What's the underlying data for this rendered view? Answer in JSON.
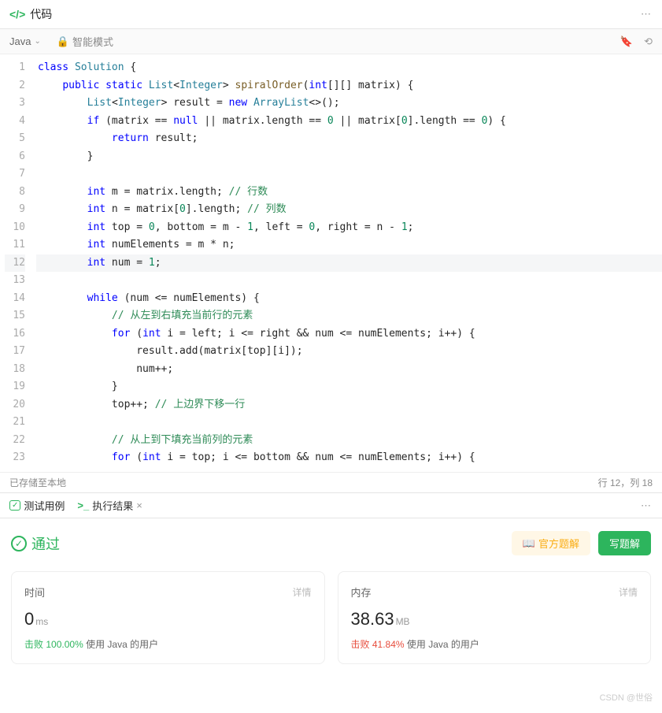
{
  "topbar": {
    "title": "代码"
  },
  "toolbar": {
    "language": "Java",
    "mode": "智能模式"
  },
  "editor": {
    "highlight_line": 12,
    "lines": [
      {
        "n": 1,
        "html": "<span class='kw'>class</span> <span class='cls'>Solution</span> {"
      },
      {
        "n": 2,
        "html": "    <span class='kw'>public</span> <span class='kw'>static</span> <span class='cls'>List</span>&lt;<span class='cls'>Integer</span>&gt; <span class='fn'>spiralOrder</span>(<span class='kw'>int</span>[][] matrix) {"
      },
      {
        "n": 3,
        "html": "        <span class='cls'>List</span>&lt;<span class='cls'>Integer</span>&gt; result = <span class='kw'>new</span> <span class='cls'>ArrayList</span>&lt;&gt;();"
      },
      {
        "n": 4,
        "html": "        <span class='kw'>if</span> (matrix == <span class='kw'>null</span> || matrix.length == <span class='num'>0</span> || matrix[<span class='num'>0</span>].length == <span class='num'>0</span>) {"
      },
      {
        "n": 5,
        "html": "            <span class='kw'>return</span> result;"
      },
      {
        "n": 6,
        "html": "        }"
      },
      {
        "n": 7,
        "html": ""
      },
      {
        "n": 8,
        "html": "        <span class='kw'>int</span> m = matrix.length; <span class='cmt'>// 行数</span>"
      },
      {
        "n": 9,
        "html": "        <span class='kw'>int</span> n = matrix[<span class='num'>0</span>].length; <span class='cmt'>// 列数</span>"
      },
      {
        "n": 10,
        "html": "        <span class='kw'>int</span> top = <span class='num'>0</span>, bottom = m - <span class='num'>1</span>, left = <span class='num'>0</span>, right = n - <span class='num'>1</span>;"
      },
      {
        "n": 11,
        "html": "        <span class='kw'>int</span> numElements = m * n;"
      },
      {
        "n": 12,
        "html": "        <span class='kw'>int</span> num = <span class='num'>1</span>;"
      },
      {
        "n": 13,
        "html": ""
      },
      {
        "n": 14,
        "html": "        <span class='kw'>while</span> (num &lt;= numElements) {"
      },
      {
        "n": 15,
        "html": "            <span class='cmt'>// 从左到右填充当前行的元素</span>"
      },
      {
        "n": 16,
        "html": "            <span class='kw'>for</span> (<span class='kw'>int</span> i = left; i &lt;= right &amp;&amp; num &lt;= numElements; i++) {"
      },
      {
        "n": 17,
        "html": "                result.add(matrix[top][i]);"
      },
      {
        "n": 18,
        "html": "                num++;"
      },
      {
        "n": 19,
        "html": "            }"
      },
      {
        "n": 20,
        "html": "            top++; <span class='cmt'>// 上边界下移一行</span>"
      },
      {
        "n": 21,
        "html": ""
      },
      {
        "n": 22,
        "html": "            <span class='cmt'>// 从上到下填充当前列的元素</span>"
      },
      {
        "n": 23,
        "html": "            <span class='kw'>for</span> (<span class='kw'>int</span> i = top; i &lt;= bottom &amp;&amp; num &lt;= numElements; i++) {"
      }
    ]
  },
  "status": {
    "saved": "已存储至本地",
    "cursor": "行 12，列 18"
  },
  "tabs": {
    "test": "测试用例",
    "exec": "执行结果"
  },
  "result": {
    "status": "通过",
    "official_btn": "官方题解",
    "write_btn": "写题解",
    "time": {
      "title": "时间",
      "detail": "详情",
      "value": "0",
      "unit": "ms",
      "beat_label": "击败",
      "beat_pct": "100.00%",
      "beat_suffix": "使用 Java 的用户",
      "color": "g"
    },
    "memory": {
      "title": "内存",
      "detail": "详情",
      "value": "38.63",
      "unit": "MB",
      "beat_label": "击败",
      "beat_pct": "41.84%",
      "beat_suffix": "使用 Java 的用户",
      "color": "r"
    }
  },
  "watermark": "CSDN @世俗"
}
